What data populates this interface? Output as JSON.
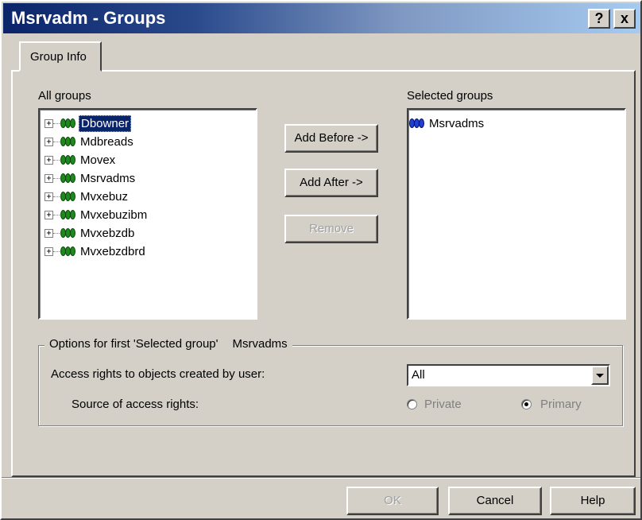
{
  "window": {
    "title": "Msrvadm - Groups",
    "help_glyph": "?",
    "close_glyph": "x"
  },
  "tabs": [
    {
      "label": "Group Info"
    }
  ],
  "all_groups": {
    "label": "All groups",
    "items": [
      {
        "label": "Dbowner",
        "selected": true
      },
      {
        "label": "Mdbreads"
      },
      {
        "label": "Movex"
      },
      {
        "label": "Msrvadms"
      },
      {
        "label": "Mvxebuz"
      },
      {
        "label": "Mvxebuzibm"
      },
      {
        "label": "Mvxebzdb"
      },
      {
        "label": "Mvxebzdbrd"
      }
    ]
  },
  "actions": {
    "add_before": "Add  Before ->",
    "add_after": "Add After ->",
    "remove": "Remove"
  },
  "selected_groups": {
    "label": "Selected groups",
    "items": [
      {
        "label": "Msrvadms"
      }
    ]
  },
  "options": {
    "legend": "Options for first 'Selected group'",
    "group_name": "Msrvadms",
    "access_label": "Access rights to objects created by user:",
    "access_value": "All",
    "source_label": "Source of access rights:",
    "radio_private": "Private",
    "radio_primary": "Primary",
    "selected_source": "Primary"
  },
  "footer": {
    "ok": "OK",
    "cancel": "Cancel",
    "help": "Help"
  },
  "colors": {
    "face": "#d4d0c8",
    "title_start": "#0a246a",
    "title_end": "#a6caf0",
    "selection": "#0a246a",
    "group_icon": "#1e8a1e",
    "selected_group_icon": "#2040d0"
  }
}
